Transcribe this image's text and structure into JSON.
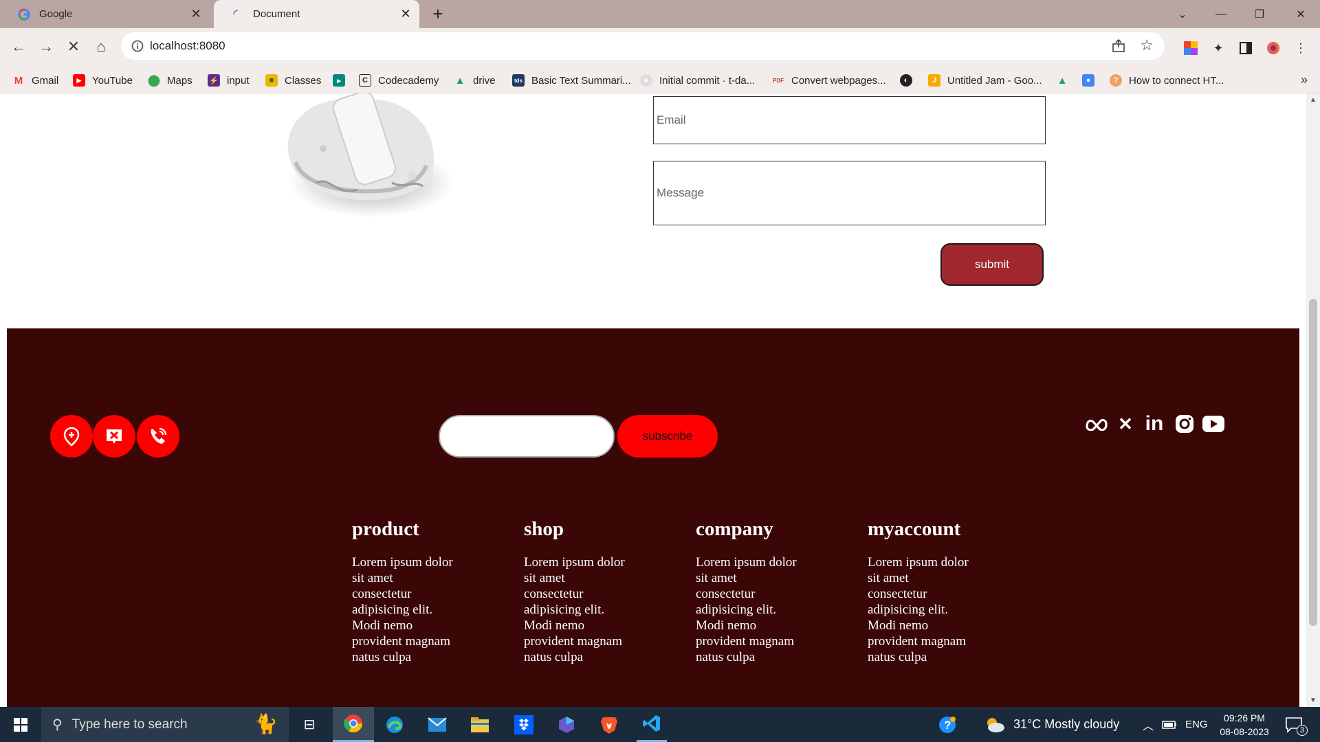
{
  "browser": {
    "tabs": [
      {
        "title": "Google"
      },
      {
        "title": "Document"
      }
    ],
    "url": "localhost:8080",
    "bookmarks": [
      {
        "label": "Gmail",
        "icon": "gmail-icon"
      },
      {
        "label": "YouTube",
        "icon": "youtube-icon"
      },
      {
        "label": "Maps",
        "icon": "maps-icon"
      },
      {
        "label": "input",
        "icon": "bolt-icon"
      },
      {
        "label": "Classes",
        "icon": "classroom-icon"
      },
      {
        "label": "",
        "icon": "meet-icon"
      },
      {
        "label": "Codecademy",
        "icon": "codecademy-icon"
      },
      {
        "label": "drive",
        "icon": "drive-icon"
      },
      {
        "label": "Basic Text Summari...",
        "icon": "tds-icon"
      },
      {
        "label": "Initial commit · t-da...",
        "icon": "github-icon"
      },
      {
        "label": "Convert webpages...",
        "icon": "pdf-icon"
      },
      {
        "label": "",
        "icon": "globe-icon"
      },
      {
        "label": "Untitled Jam - Goo...",
        "icon": "jamboard-icon"
      },
      {
        "label": "",
        "icon": "drive-icon"
      },
      {
        "label": "",
        "icon": "contacts-icon"
      },
      {
        "label": "How to connect HT...",
        "icon": "site-icon"
      }
    ]
  },
  "form": {
    "email_placeholder": "Email",
    "message_placeholder": "Message",
    "submit_label": "submit"
  },
  "footer": {
    "subscribe_label": "subscribe",
    "contact_icons": [
      "location-icon",
      "mail-icon",
      "phone-icon"
    ],
    "social_icons": [
      "meta-icon",
      "x-icon",
      "linkedin-icon",
      "instagram-icon",
      "youtube-icon"
    ],
    "columns": [
      {
        "title": "product",
        "text": "Lorem ipsum dolor sit amet consectetur adipisicing elit. Modi nemo provident magnam natus culpa"
      },
      {
        "title": "shop",
        "text": "Lorem ipsum dolor sit amet consectetur adipisicing elit. Modi nemo provident magnam natus culpa"
      },
      {
        "title": "company",
        "text": "Lorem ipsum dolor sit amet consectetur adipisicing elit. Modi nemo provident magnam natus culpa"
      },
      {
        "title": "myaccount",
        "text": "Lorem ipsum dolor sit amet consectetur adipisicing elit. Modi nemo provident magnam natus culpa"
      }
    ]
  },
  "taskbar": {
    "search_placeholder": "Type here to search",
    "weather": "31°C  Mostly cloudy",
    "language": "ENG",
    "time": "09:26 PM",
    "date": "08-08-2023",
    "notification_count": "3"
  },
  "colors": {
    "footer_bg": "#3a0606",
    "accent_red": "#ff0000",
    "submit_bg": "#a0282e"
  }
}
